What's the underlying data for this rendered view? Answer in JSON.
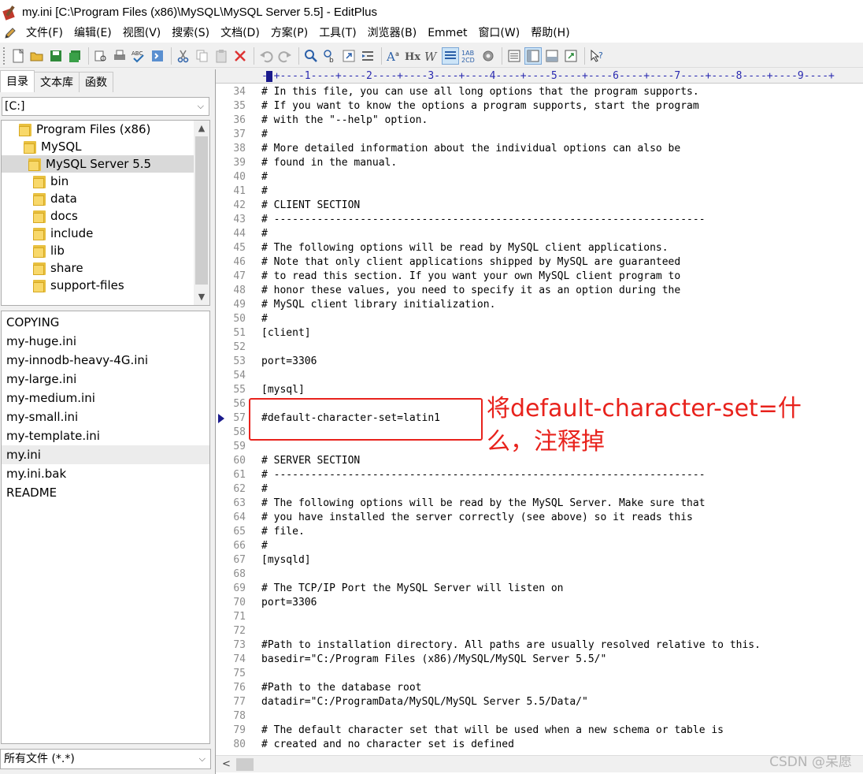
{
  "window": {
    "title": "my.ini [C:\\Program Files (x86)\\MySQL\\MySQL Server 5.5] - EditPlus"
  },
  "menu": [
    "文件(F)",
    "编辑(E)",
    "视图(V)",
    "搜索(S)",
    "文档(D)",
    "方案(P)",
    "工具(T)",
    "浏览器(B)",
    "Emmet",
    "窗口(W)",
    "帮助(H)"
  ],
  "toolbar_icons": [
    "new-file-icon",
    "open-folder-icon",
    "save-icon",
    "save-all-icon",
    "print-preview-icon",
    "print-icon",
    "spell-check-icon",
    "browser-preview-icon",
    "cut-icon",
    "copy-icon",
    "paste-icon",
    "delete-icon",
    "undo-icon",
    "redo-icon",
    "find-icon",
    "replace-icon",
    "goto-icon",
    "indent-icon",
    "font-icon",
    "heading-icon",
    "word-wrap-icon",
    "line-format-icon",
    "line-number-icon",
    "settings-icon",
    "document-selector-icon",
    "directory-window-icon",
    "output-window-icon",
    "fullscreen-icon",
    "help-icon"
  ],
  "left_panel": {
    "tabs": [
      "目录",
      "文本库",
      "函数"
    ],
    "active_tab": 0,
    "drive": "[C:]",
    "folders": [
      {
        "name": "Program Files (x86)",
        "indent": 0
      },
      {
        "name": "MySQL",
        "indent": 1
      },
      {
        "name": "MySQL Server 5.5",
        "indent": 2,
        "selected": true
      },
      {
        "name": "bin",
        "indent": 3
      },
      {
        "name": "data",
        "indent": 3
      },
      {
        "name": "docs",
        "indent": 3
      },
      {
        "name": "include",
        "indent": 3
      },
      {
        "name": "lib",
        "indent": 3
      },
      {
        "name": "share",
        "indent": 3
      },
      {
        "name": "support-files",
        "indent": 3
      }
    ],
    "files": [
      "COPYING",
      "my-huge.ini",
      "my-innodb-heavy-4G.ini",
      "my-large.ini",
      "my-medium.ini",
      "my-small.ini",
      "my-template.ini",
      "my.ini",
      "my.ini.bak",
      "README"
    ],
    "selected_file": "my.ini",
    "filter": "所有文件 (*.*)"
  },
  "editor": {
    "ruler": "--+----1----+----2----+----3----+----4----+----5----+----6----+----7----+----8----+----9----+",
    "current_line": 57,
    "lines": [
      {
        "n": 34,
        "text": "# In this file, you can use all long options that the program supports."
      },
      {
        "n": 35,
        "text": "# If you want to know the options a program supports, start the program"
      },
      {
        "n": 36,
        "text": "# with the \"--help\" option."
      },
      {
        "n": 37,
        "text": "#"
      },
      {
        "n": 38,
        "text": "# More detailed information about the individual options can also be"
      },
      {
        "n": 39,
        "text": "# found in the manual."
      },
      {
        "n": 40,
        "text": "#"
      },
      {
        "n": 41,
        "text": "#"
      },
      {
        "n": 42,
        "text": "# CLIENT SECTION"
      },
      {
        "n": 43,
        "text": "# ----------------------------------------------------------------------"
      },
      {
        "n": 44,
        "text": "#"
      },
      {
        "n": 45,
        "text": "# The following options will be read by MySQL client applications."
      },
      {
        "n": 46,
        "text": "# Note that only client applications shipped by MySQL are guaranteed"
      },
      {
        "n": 47,
        "text": "# to read this section. If you want your own MySQL client program to"
      },
      {
        "n": 48,
        "text": "# honor these values, you need to specify it as an option during the"
      },
      {
        "n": 49,
        "text": "# MySQL client library initialization."
      },
      {
        "n": 50,
        "text": "#"
      },
      {
        "n": 51,
        "text": "[client]"
      },
      {
        "n": 52,
        "text": ""
      },
      {
        "n": 53,
        "text": "port=3306"
      },
      {
        "n": 54,
        "text": ""
      },
      {
        "n": 55,
        "text": "[mysql]"
      },
      {
        "n": 56,
        "text": ""
      },
      {
        "n": 57,
        "text": "#default-character-set=latin1"
      },
      {
        "n": 58,
        "text": ""
      },
      {
        "n": 59,
        "text": ""
      },
      {
        "n": 60,
        "text": "# SERVER SECTION"
      },
      {
        "n": 61,
        "text": "# ----------------------------------------------------------------------"
      },
      {
        "n": 62,
        "text": "#"
      },
      {
        "n": 63,
        "text": "# The following options will be read by the MySQL Server. Make sure that"
      },
      {
        "n": 64,
        "text": "# you have installed the server correctly (see above) so it reads this"
      },
      {
        "n": 65,
        "text": "# file."
      },
      {
        "n": 66,
        "text": "#"
      },
      {
        "n": 67,
        "text": "[mysqld]"
      },
      {
        "n": 68,
        "text": ""
      },
      {
        "n": 69,
        "text": "# The TCP/IP Port the MySQL Server will listen on"
      },
      {
        "n": 70,
        "text": "port=3306"
      },
      {
        "n": 71,
        "text": ""
      },
      {
        "n": 72,
        "text": ""
      },
      {
        "n": 73,
        "text": "#Path to installation directory. All paths are usually resolved relative to this."
      },
      {
        "n": 74,
        "text": "basedir=\"C:/Program Files (x86)/MySQL/MySQL Server 5.5/\""
      },
      {
        "n": 75,
        "text": ""
      },
      {
        "n": 76,
        "text": "#Path to the database root"
      },
      {
        "n": 77,
        "text": "datadir=\"C:/ProgramData/MySQL/MySQL Server 5.5/Data/\""
      },
      {
        "n": 78,
        "text": ""
      },
      {
        "n": 79,
        "text": "# The default character set that will be used when a new schema or table is"
      },
      {
        "n": 80,
        "text": "# created and no character set is defined"
      }
    ]
  },
  "annotation": {
    "text": "将default-character-set=什么，注释掉",
    "color": "#e8221c"
  },
  "watermark": "CSDN @呆愿"
}
